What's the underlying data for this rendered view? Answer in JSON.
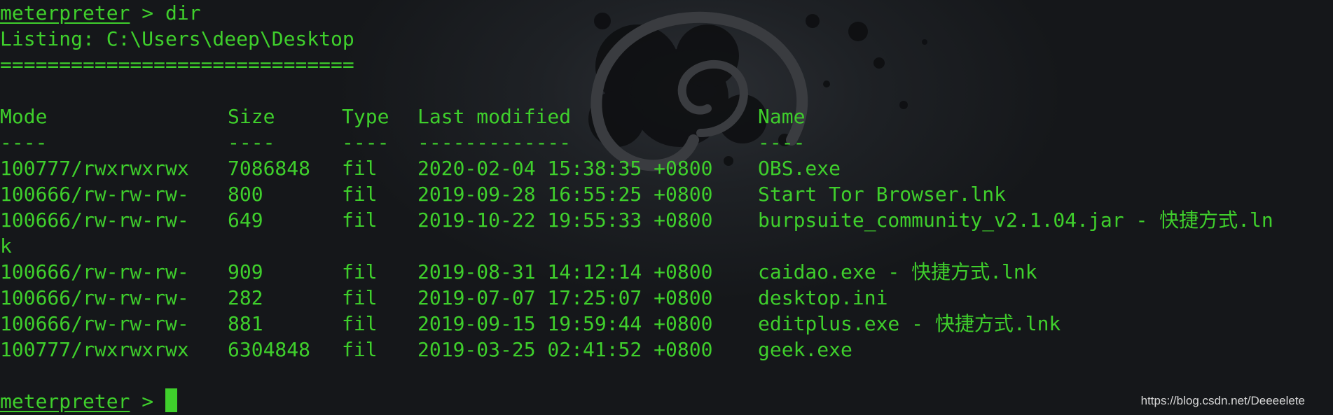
{
  "terminal": {
    "command_line": {
      "prompt": "meterpreter",
      "separator": " > ",
      "command": "dir"
    },
    "listing_header": "Listing: C:\\Users\\deep\\Desktop",
    "listing_underline": "==============================",
    "columns": {
      "mode": "Mode",
      "size": "Size",
      "type": "Type",
      "modified": "Last modified",
      "name": "Name"
    },
    "column_rules": {
      "mode": "----",
      "size": "----",
      "type": "----",
      "modified": "-------------",
      "name": "----"
    },
    "rows": [
      {
        "mode": "100777/rwxrwxrwx",
        "size": "7086848",
        "type": "fil",
        "modified": "2020-02-04 15:38:35 +0800",
        "name": "OBS.exe"
      },
      {
        "mode": "100666/rw-rw-rw-",
        "size": "800",
        "type": "fil",
        "modified": "2019-09-28 16:55:25 +0800",
        "name": "Start Tor Browser.lnk"
      },
      {
        "mode": "100666/rw-rw-rw-",
        "size": "649",
        "type": "fil",
        "modified": "2019-10-22 19:55:33 +0800",
        "name": "burpsuite_community_v2.1.04.jar - 快捷方式.ln",
        "wrap": "k"
      },
      {
        "mode": "100666/rw-rw-rw-",
        "size": "909",
        "type": "fil",
        "modified": "2019-08-31 14:12:14 +0800",
        "name": "caidao.exe - 快捷方式.lnk"
      },
      {
        "mode": "100666/rw-rw-rw-",
        "size": "282",
        "type": "fil",
        "modified": "2019-07-07 17:25:07 +0800",
        "name": "desktop.ini"
      },
      {
        "mode": "100666/rw-rw-rw-",
        "size": "881",
        "type": "fil",
        "modified": "2019-09-15 19:59:44 +0800",
        "name": "editplus.exe - 快捷方式.lnk"
      },
      {
        "mode": "100777/rwxrwxrwx",
        "size": "6304848",
        "type": "fil",
        "modified": "2019-03-25 02:41:52 +0800",
        "name": "geek.exe"
      }
    ],
    "final_prompt": {
      "prompt": "meterpreter",
      "separator": " > "
    }
  },
  "watermark": "https://blog.csdn.net/Deeeelete",
  "colors": {
    "text": "#3fcf2c",
    "background": "#16181b",
    "watermark": "#d8d8d8"
  },
  "icons": {
    "background": "debian-swirl-logo"
  }
}
